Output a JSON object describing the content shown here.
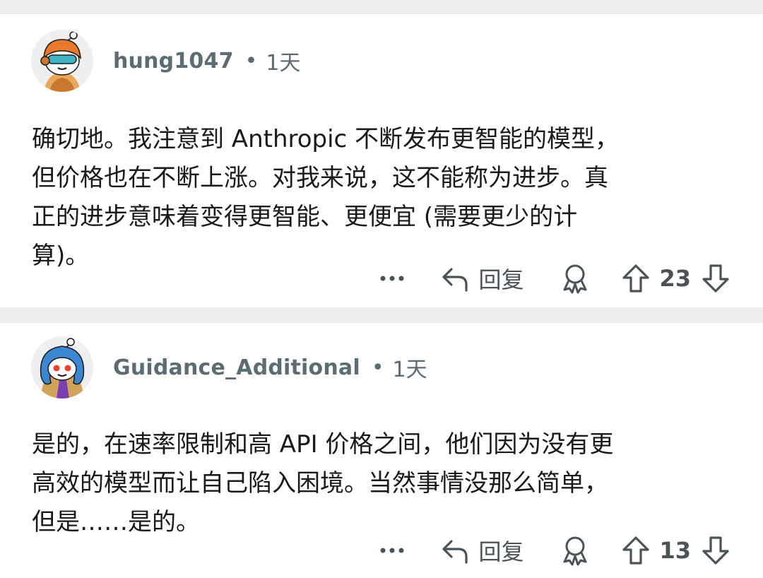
{
  "comments": [
    {
      "username": "hung1047",
      "separator": "•",
      "time": "1天",
      "text": "确切地。我注意到 Anthropic 不断发布更智能的模型，\n但价格也在不断上涨。对我来说，这不能称为进步。真\n正的进步意味着变得更智能、更便宜 (需要更少的计\n算)。",
      "reply_label": "回复",
      "score": "23",
      "avatar_icon": "snoo-avatar-orange-helmet-icon"
    },
    {
      "username": "Guidance_Additional",
      "separator": "•",
      "time": "1天",
      "text": "是的，在速率限制和高 API 价格之间，他们因为没有更\n高效的模型而让自己陷入困境。当然事情没那么简单，\n但是……是的。",
      "reply_label": "回复",
      "score": "13",
      "avatar_icon": "snoo-avatar-hooded-icon"
    }
  ],
  "colors": {
    "background": "#ffffff",
    "divider": "#ededed",
    "meta_text": "#5c6c74",
    "body_text": "#1a1a1b",
    "icon": "#4a5358"
  }
}
